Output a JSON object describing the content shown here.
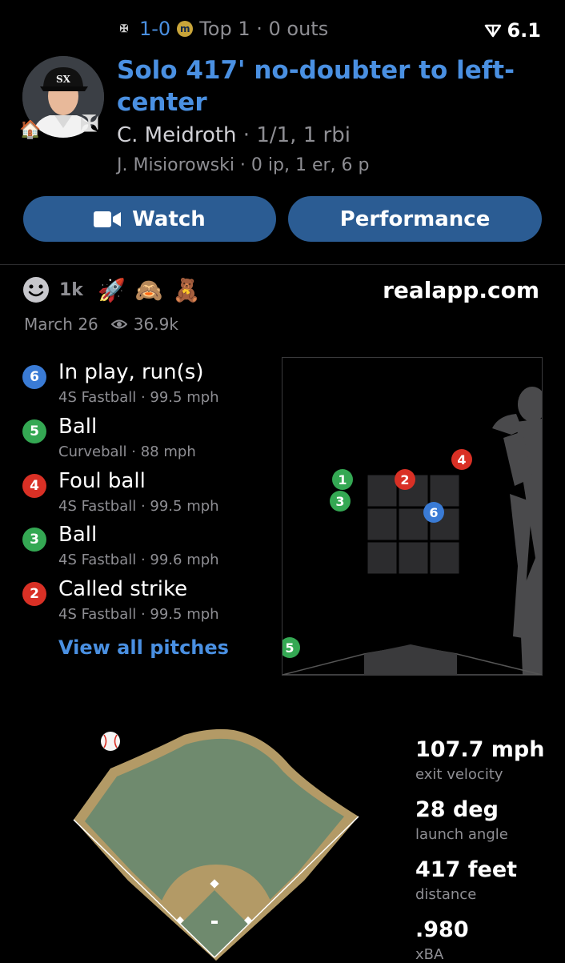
{
  "header": {
    "score": "1-0",
    "inning": "Top 1 · 0 outs",
    "signal_value": "6.1",
    "headline": "Solo 417' no-doubter to left-center",
    "batter_name": "C. Meidroth",
    "batter_line": " · 1/1, 1 rbi",
    "pitcher_line": "J. Misiorowski · 0 ip, 1 er, 6 p"
  },
  "icons": {
    "away_team": "white-sox-logo",
    "home_team": "brewers-logo",
    "signal": "signal-icon",
    "watch": "video-camera-icon",
    "home_badge": "house-icon",
    "views": "eye-icon"
  },
  "buttons": {
    "watch": "Watch",
    "performance": "Performance"
  },
  "social": {
    "reaction_count": "1k",
    "emojis": [
      "🚀",
      "🙈",
      "🧸"
    ],
    "site": "realapp.com",
    "date": "March 26",
    "views": "36.9k"
  },
  "pitches": [
    {
      "num": "6",
      "color": "#3a7bd5",
      "result": "In play, run(s)",
      "detail": "4S Fastball · 99.5 mph"
    },
    {
      "num": "5",
      "color": "#34a853",
      "result": "Ball",
      "detail": "Curveball · 88 mph"
    },
    {
      "num": "4",
      "color": "#d93025",
      "result": "Foul ball",
      "detail": "4S Fastball · 99.5 mph"
    },
    {
      "num": "3",
      "color": "#34a853",
      "result": "Ball",
      "detail": "4S Fastball · 99.6 mph"
    },
    {
      "num": "2",
      "color": "#d93025",
      "result": "Called strike",
      "detail": "4S Fastball · 99.5 mph"
    }
  ],
  "view_all_label": "View all pitches",
  "zone_markers": [
    {
      "num": "1",
      "color": "#34a853"
    },
    {
      "num": "2",
      "color": "#d93025"
    },
    {
      "num": "3",
      "color": "#34a853"
    },
    {
      "num": "4",
      "color": "#d93025"
    },
    {
      "num": "5",
      "color": "#34a853"
    },
    {
      "num": "6",
      "color": "#3a7bd5"
    }
  ],
  "stats": [
    {
      "value": "107.7 mph",
      "label": "exit velocity"
    },
    {
      "value": "28 deg",
      "label": "launch angle"
    },
    {
      "value": "417 feet",
      "label": "distance"
    },
    {
      "value": ".980",
      "label": "xBA"
    }
  ],
  "colors": {
    "accent": "#4a90e2",
    "button": "#2b5c93",
    "field_grass": "#6f8a6e",
    "field_dirt": "#b39a66"
  }
}
